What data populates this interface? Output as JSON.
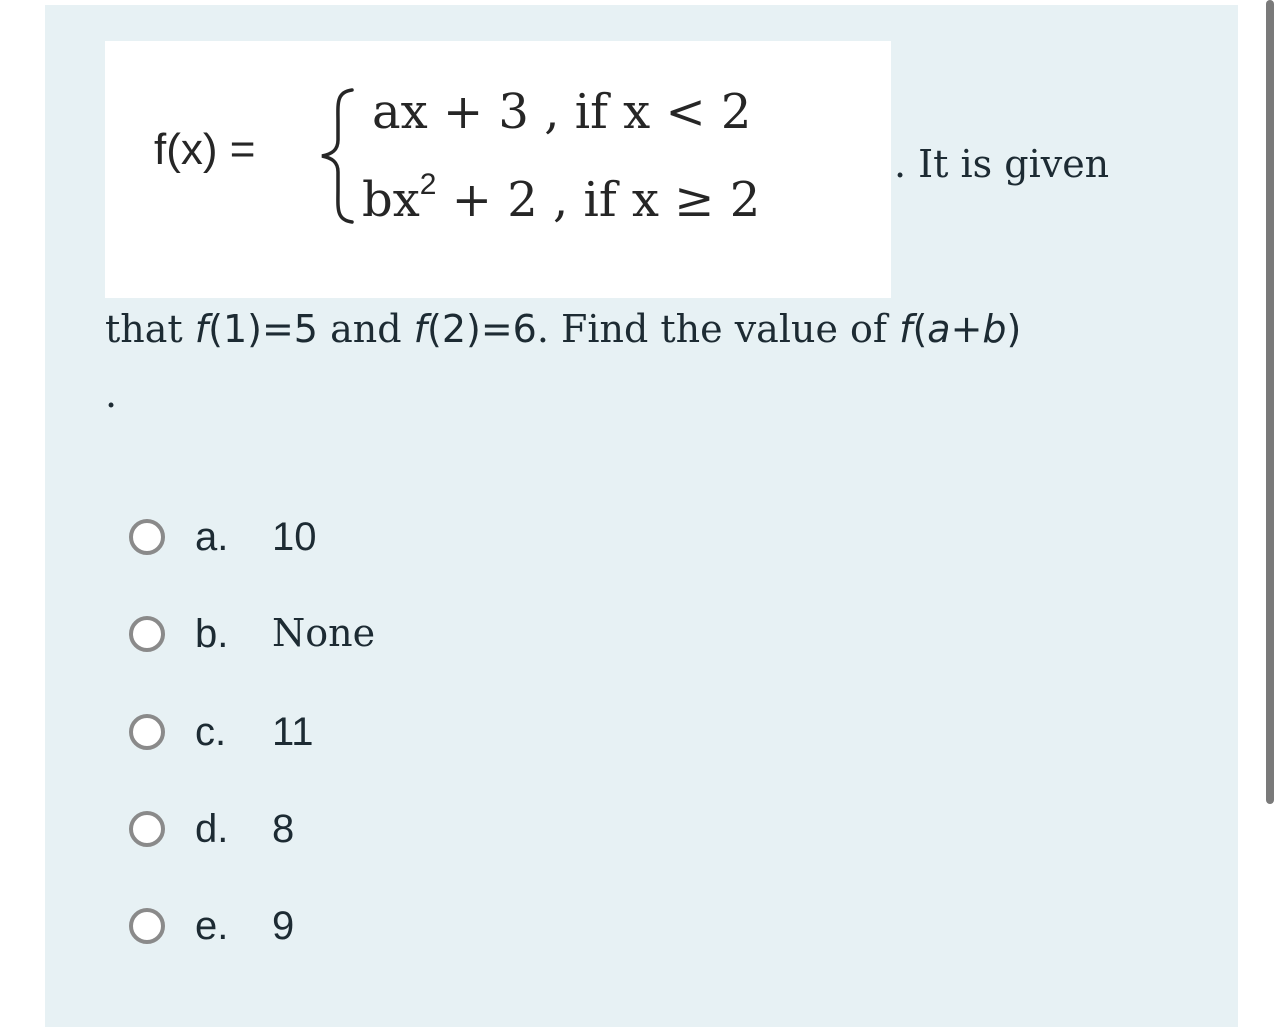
{
  "question": {
    "formula": {
      "fx": "f(x) =",
      "case1": "ax + 3 , if x < 2",
      "case2_base": "bx",
      "case2_exp": "2",
      "case2_rest": " + 2 , if x ≥ 2"
    },
    "after_formula": ". It is given",
    "line2": {
      "t1": "that ",
      "f1": "f",
      "m1": "(1)=5",
      "t2": " and ",
      "f2": "f",
      "m2": "(2)=6",
      "t3": ". Find the value of ",
      "f3": "f",
      "m3a": "(",
      "a": "a",
      "m3b": "+",
      "b": "b",
      "m3c": ")"
    },
    "trailing": "."
  },
  "options": [
    {
      "letter": "a.",
      "value": "10"
    },
    {
      "letter": "b.",
      "value": "None"
    },
    {
      "letter": "c.",
      "value": "11"
    },
    {
      "letter": "d.",
      "value": "8"
    },
    {
      "letter": "e.",
      "value": "9"
    }
  ]
}
